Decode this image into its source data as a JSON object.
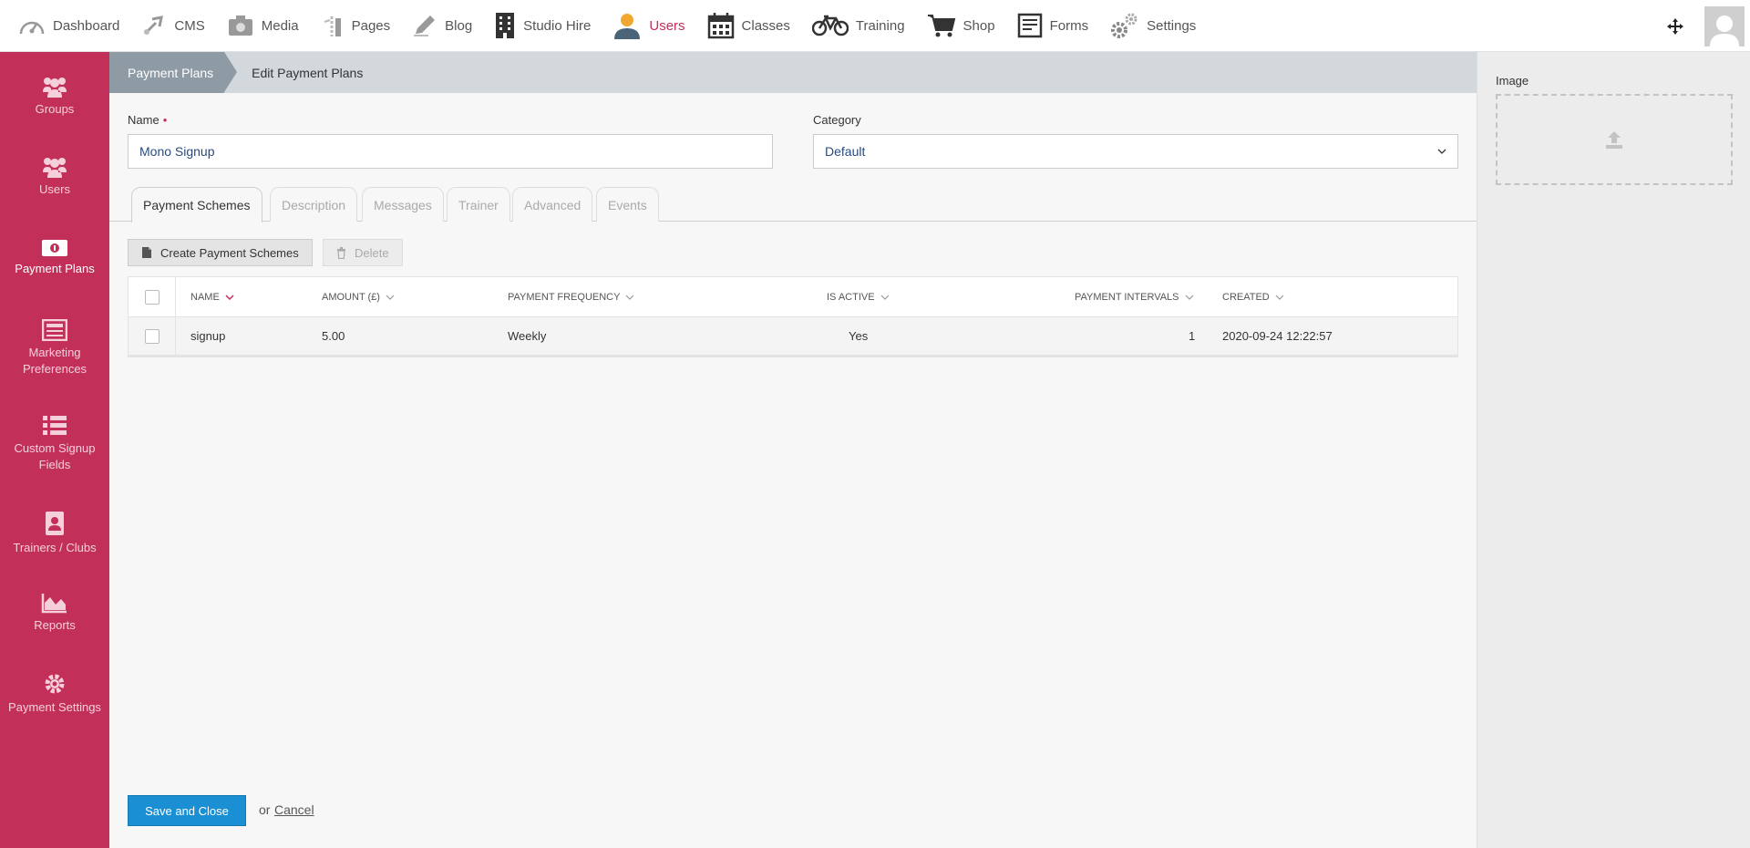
{
  "topnav": {
    "items": [
      {
        "label": "Dashboard",
        "icon": "dashboard-gauge-icon"
      },
      {
        "label": "CMS",
        "icon": "cms-tools-icon"
      },
      {
        "label": "Media",
        "icon": "media-camera-icon"
      },
      {
        "label": "Pages",
        "icon": "pages-icon"
      },
      {
        "label": "Blog",
        "icon": "blog-pencil-icon"
      },
      {
        "label": "Studio Hire",
        "icon": "building-icon"
      },
      {
        "label": "Users",
        "icon": "user-icon",
        "active": true
      },
      {
        "label": "Classes",
        "icon": "calendar-icon"
      },
      {
        "label": "Training",
        "icon": "bicycle-icon"
      },
      {
        "label": "Shop",
        "icon": "cart-icon"
      },
      {
        "label": "Forms",
        "icon": "form-icon"
      },
      {
        "label": "Settings",
        "icon": "gears-icon"
      }
    ]
  },
  "sidebar": {
    "items": [
      {
        "label": "Groups",
        "icon": "users-group-icon"
      },
      {
        "label": "Users",
        "icon": "users-icon"
      },
      {
        "label": "Payment Plans",
        "icon": "money-icon",
        "active": true
      },
      {
        "label": "Marketing Preferences",
        "icon": "newspaper-icon"
      },
      {
        "label": "Custom Signup Fields",
        "icon": "list-icon"
      },
      {
        "label": "Trainers / Clubs",
        "icon": "address-book-icon"
      },
      {
        "label": "Reports",
        "icon": "area-chart-icon"
      },
      {
        "label": "Payment Settings",
        "icon": "cog-icon"
      }
    ]
  },
  "breadcrumb": {
    "parent": "Payment Plans",
    "current": "Edit Payment Plans"
  },
  "form": {
    "name_label": "Name",
    "name_required": "•",
    "name_value": "Mono Signup",
    "category_label": "Category",
    "category_value": "Default"
  },
  "tabs": [
    "Payment Schemes",
    "Description",
    "Messages",
    "Trainer",
    "Advanced",
    "Events"
  ],
  "toolbar": {
    "create_label": "Create Payment Schemes",
    "delete_label": "Delete"
  },
  "table": {
    "columns": [
      "Name",
      "Amount (£)",
      "Payment Frequency",
      "Is Active",
      "Payment Intervals",
      "Created"
    ],
    "rows": [
      {
        "name": "signup",
        "amount": "5.00",
        "frequency": "Weekly",
        "active": "Yes",
        "intervals": "1",
        "created": "2020-09-24 12:22:57"
      }
    ]
  },
  "right_panel": {
    "image_label": "Image"
  },
  "footer": {
    "save_label": "Save and Close",
    "or_text": "or",
    "cancel_label": "Cancel"
  },
  "colors": {
    "brand": "#c2305a",
    "primary_button": "#1b8fd3",
    "breadcrumb_active": "#8e9aa4"
  }
}
